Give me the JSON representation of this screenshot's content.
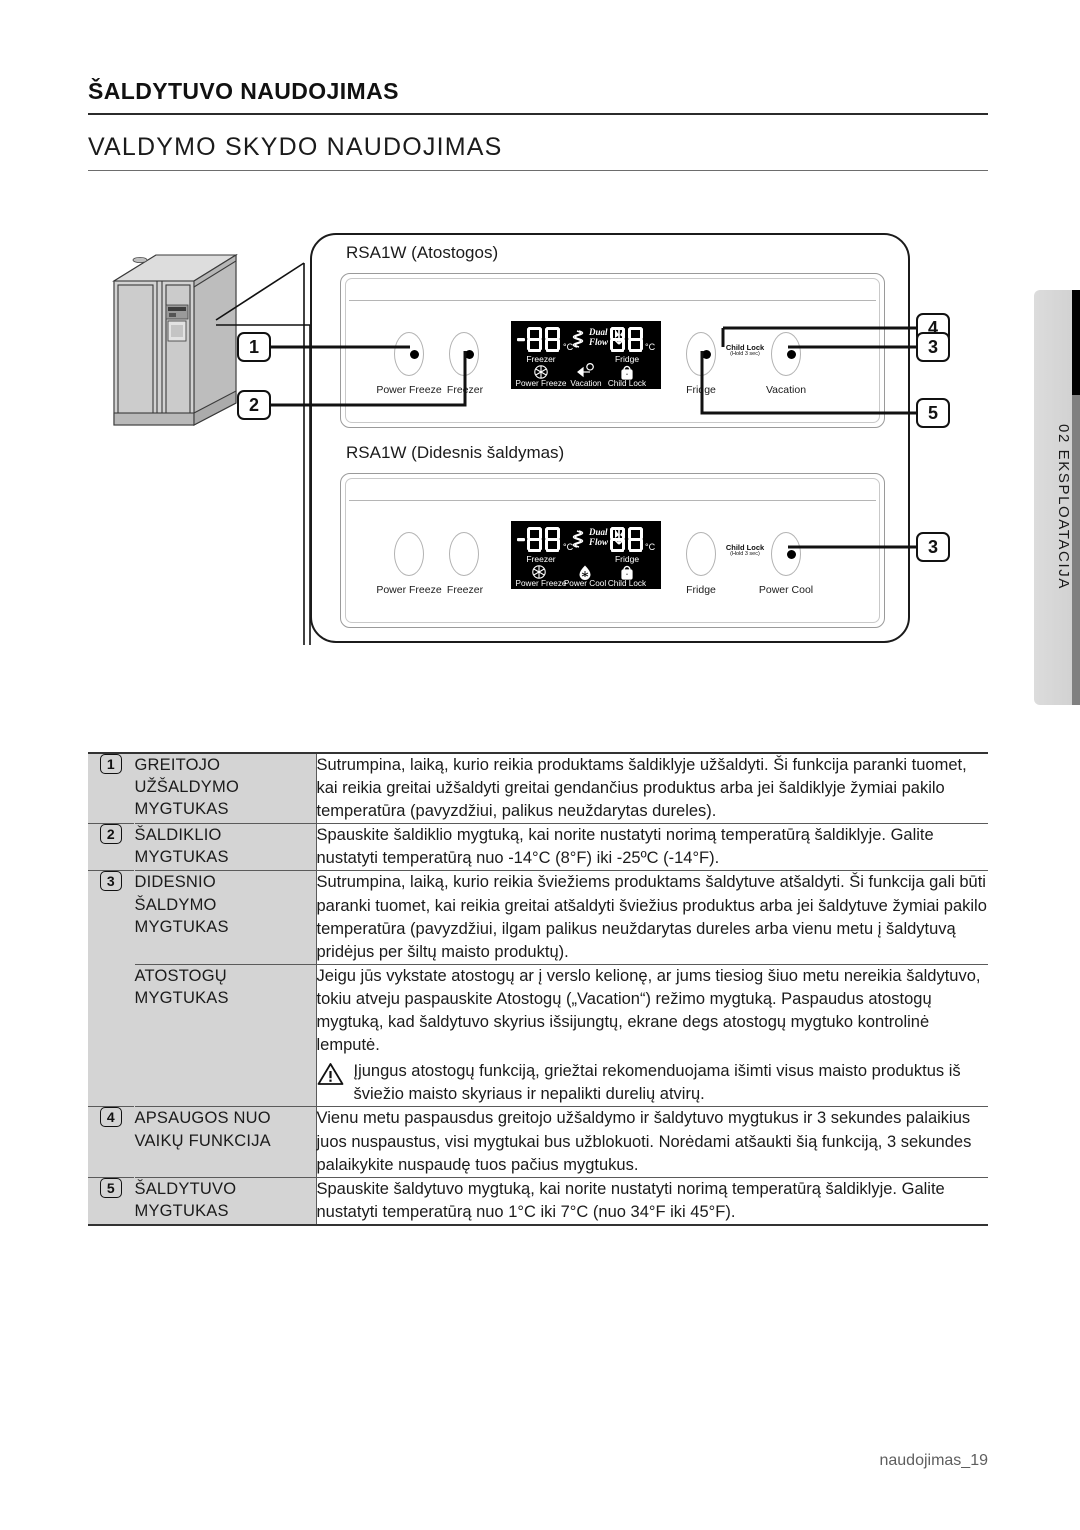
{
  "document": {
    "chapter_heading": "ŠALDYTUVO NAUDOJIMAS",
    "section_heading": "VALDYMO SKYDO NAUDOJIMAS",
    "side_tab": "02 EKSPLOATACIJA",
    "footer": "naudojimas_19"
  },
  "diagram": {
    "panel1": {
      "title": "RSA1W (Atostogos)",
      "buttons": [
        {
          "label": "Power Freeze"
        },
        {
          "label": "Freezer"
        },
        {
          "label": "Fridge"
        },
        {
          "label": "Vacation"
        }
      ],
      "child_lock_tag": "Child Lock",
      "child_lock_hint": "(Hold 3 sec)",
      "lcd": {
        "minus": "-",
        "left_digits": "88",
        "left_unit": "°C",
        "left_label": "Freezer",
        "center_text_1": "Dual",
        "center_text_2": "Flow",
        "right_digits": "88",
        "right_unit": "°C",
        "right_label": "Fridge",
        "indicators": [
          {
            "icon": "snowflake-icon",
            "label": "Power Freeze"
          },
          {
            "icon": "vacation-icon",
            "label": "Vacation"
          },
          {
            "icon": "padlock-icon",
            "label": "Child Lock"
          }
        ]
      }
    },
    "panel2": {
      "title": "RSA1W (Didesnis šaldymas)",
      "buttons": [
        {
          "label": "Power Freeze"
        },
        {
          "label": "Freezer"
        },
        {
          "label": "Fridge"
        },
        {
          "label": "Power Cool"
        }
      ],
      "child_lock_tag": "Child Lock",
      "child_lock_hint": "(Hold 3 sec)",
      "lcd": {
        "minus": "-",
        "left_digits": "88",
        "left_unit": "°C",
        "left_label": "Freezer",
        "center_text_1": "Dual",
        "center_text_2": "Flow",
        "right_digits": "88",
        "right_unit": "°C",
        "right_label": "Fridge",
        "indicators": [
          {
            "icon": "snowflake-icon",
            "label": "Power Freeze"
          },
          {
            "icon": "waterdrop-icon",
            "label": "Power Cool"
          },
          {
            "icon": "padlock-icon",
            "label": "Child Lock"
          }
        ]
      }
    },
    "callouts": {
      "one": "1",
      "two": "2",
      "three_top": "3",
      "four": "4",
      "five": "5",
      "three_bottom": "3"
    }
  },
  "table": {
    "rows": [
      {
        "num": "1",
        "name": "GREITOJO\nUŽŠALDYMO\nMYGTUKAS",
        "desc": "Sutrumpina, laiką, kurio reikia produktams šaldiklyje užšaldyti. Ši funkcija paranki tuomet, kai reikia greitai užšaldyti greitai gendančius produktus arba jei šaldiklyje žymiai pakilo temperatūra (pavyzdžiui, palikus neuždarytas dureles)."
      },
      {
        "num": "2",
        "name": "ŠALDIKLIO\nMYGTUKAS",
        "desc": "Spauskite šaldiklio mygtuką, kai norite nustatyti norimą temperatūrą šaldiklyje. Galite nustatyti temperatūrą nuo -14°C (8°F) iki -25ºC (-14°F)."
      },
      {
        "num": "3",
        "name": "DIDESNIO\nŠALDYMO\nMYGTUKAS",
        "desc": "Sutrumpina, laiką, kurio reikia šviežiems produktams šaldytuve atšaldyti. Ši funkcija gali būti paranki tuomet, kai reikia greitai atšaldyti šviežius produktus arba jei šaldytuve žymiai pakilo temperatūra (pavyzdžiui, ilgam palikus neuždarytas dureles arba vienu metu į šaldytuvą pridėjus per šiltų maisto produktų)."
      },
      {
        "num": "",
        "name": "ATOSTOGŲ\nMYGTUKAS",
        "desc": "Jeigu jūs vykstate atostogų ar į verslo kelionę, ar jums tiesiog šiuo metu nereikia šaldytuvo, tokiu atveju paspauskite Atostogų („Vacation“) režimo mygtuką. Paspaudus atostogų mygtuką, kad šaldytuvo skyrius išsijungtų, ekrane degs atostogų mygtuko kontrolinė lemputė.",
        "warning": "Įjungus atostogų funkciją, griežtai rekomenduojama išimti visus maisto produktus iš šviežio maisto skyriaus ir nepalikti durelių atvirų."
      },
      {
        "num": "4",
        "name": "APSAUGOS NUO\nVAIKŲ FUNKCIJA",
        "desc": "Vienu metu paspausdus greitojo užšaldymo ir šaldytuvo mygtukus ir 3 sekundes palaikius juos nuspaustus, visi mygtukai bus užblokuoti. Norėdami atšaukti šią funkciją, 3 sekundes palaikykite nuspaudę tuos pačius mygtukus."
      },
      {
        "num": "5",
        "name": "ŠALDYTUVO\nMYGTUKAS",
        "desc": "Spauskite šaldytuvo mygtuką, kai norite nustatyti norimą temperatūrą šaldiklyje. Galite nustatyti temperatūrą nuo 1°C iki 7°C (nuo 34°F iki 45°F)."
      }
    ]
  },
  "colors": {
    "table_header_bg": "#d4d4d4",
    "rule": "#2b2b2b",
    "lcd_bg": "#000000",
    "side_tab_bg": "#dcdcdc",
    "footer_text": "#5e5e5e"
  }
}
